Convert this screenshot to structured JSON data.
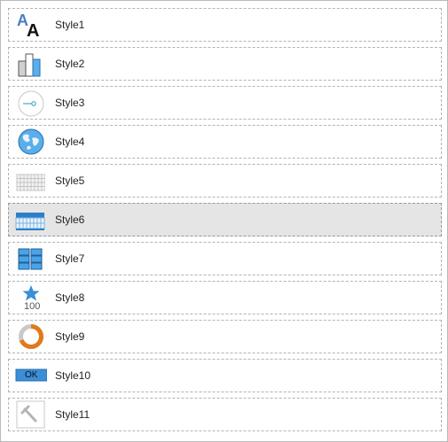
{
  "styles": [
    {
      "label": "Style1",
      "icon": "text-size-icon"
    },
    {
      "label": "Style2",
      "icon": "bar-chart-icon"
    },
    {
      "label": "Style3",
      "icon": "gauge-icon"
    },
    {
      "label": "Style4",
      "icon": "globe-icon"
    },
    {
      "label": "Style5",
      "icon": "grid-table-icon"
    },
    {
      "label": "Style6",
      "icon": "calendar-table-icon"
    },
    {
      "label": "Style7",
      "icon": "tile-grid-icon"
    },
    {
      "label": "Style8",
      "icon": "star-kpi-icon",
      "kpi_value": "100"
    },
    {
      "label": "Style9",
      "icon": "donut-icon"
    },
    {
      "label": "Style10",
      "icon": "button-icon",
      "button_text": "OK"
    },
    {
      "label": "Style11",
      "icon": "hammer-icon"
    }
  ],
  "selected_index": 5,
  "colors": {
    "accent_blue": "#3a8fd6",
    "dark_blue": "#2a6fb0",
    "orange": "#e07b1a",
    "selected_bg": "#e5e5e5"
  }
}
